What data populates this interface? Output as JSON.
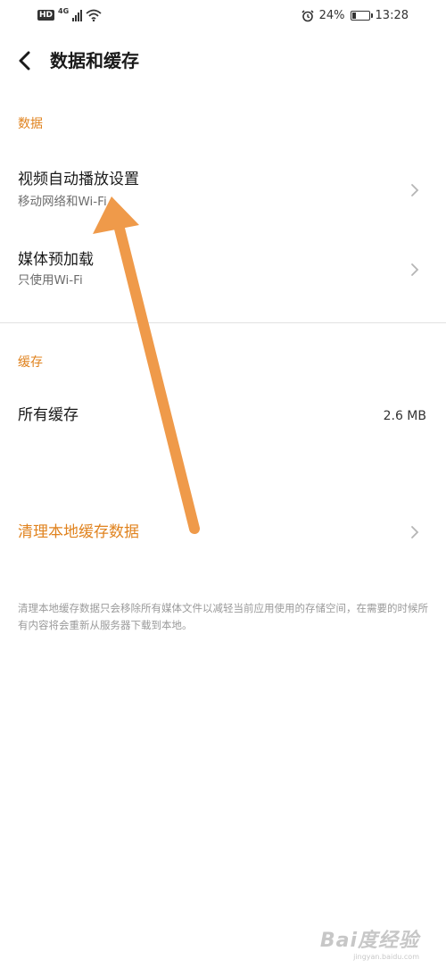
{
  "status_bar": {
    "hd": "HD",
    "network": "4G",
    "battery_text": "24%",
    "battery_level_pct": 24,
    "time": "13:28"
  },
  "header": {
    "title": "数据和缓存"
  },
  "sections": {
    "data_label": "数据",
    "cache_label": "缓存"
  },
  "rows": {
    "video_autoplay": {
      "title": "视频自动播放设置",
      "subtitle": "移动网络和Wi-Fi"
    },
    "media_preload": {
      "title": "媒体预加载",
      "subtitle": "只使用Wi-Fi"
    },
    "all_cache": {
      "title": "所有缓存",
      "value": "2.6 MB"
    },
    "clear_cache": {
      "title": "清理本地缓存数据"
    }
  },
  "note": "清理本地缓存数据只会移除所有媒体文件以减轻当前应用使用的存储空间，在需要的时候所有内容将会重新从服务器下载到本地。",
  "watermark": {
    "main": "Bai度经验",
    "sub": "jingyan.baidu.com"
  },
  "colors": {
    "accent": "#e0831f",
    "annotation_arrow": "#ef9a4a",
    "divider": "#e2e2e2"
  },
  "icons": [
    "back-arrow-icon",
    "chevron-right-icon",
    "alarm-icon",
    "wifi-icon",
    "signal-icon",
    "battery-icon"
  ]
}
